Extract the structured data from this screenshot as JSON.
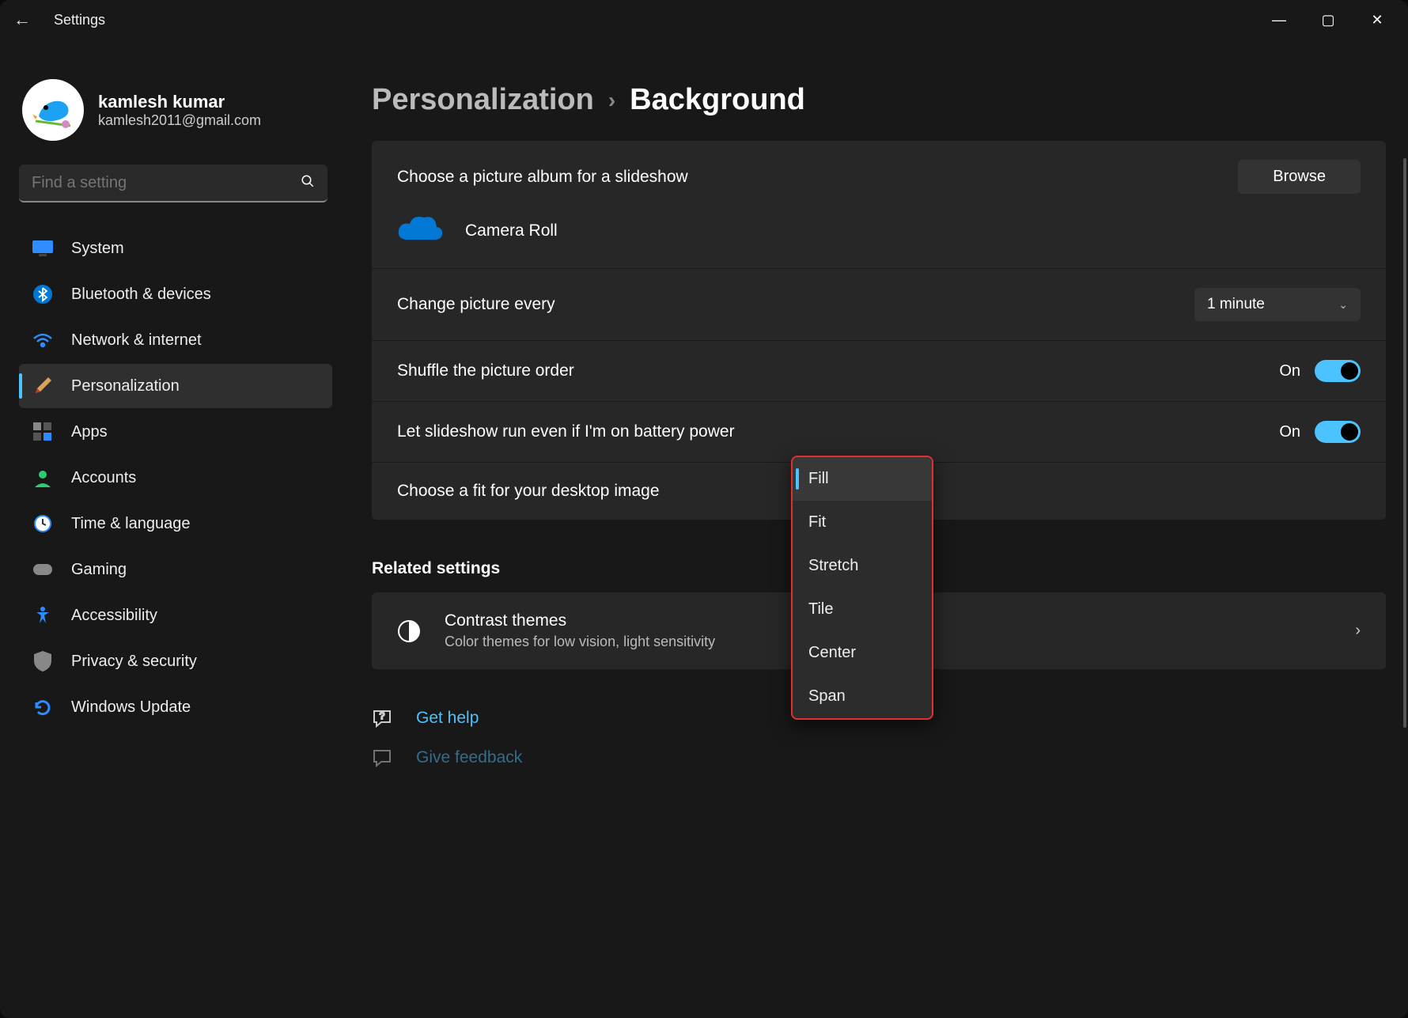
{
  "window": {
    "back_icon": "←",
    "title": "Settings",
    "min_icon": "—",
    "max_icon": "▢",
    "close_icon": "✕"
  },
  "user": {
    "name": "kamlesh kumar",
    "email": "kamlesh2011@gmail.com"
  },
  "search": {
    "placeholder": "Find a setting"
  },
  "nav": {
    "items": [
      {
        "label": "System"
      },
      {
        "label": "Bluetooth & devices"
      },
      {
        "label": "Network & internet"
      },
      {
        "label": "Personalization"
      },
      {
        "label": "Apps"
      },
      {
        "label": "Accounts"
      },
      {
        "label": "Time & language"
      },
      {
        "label": "Gaming"
      },
      {
        "label": "Accessibility"
      },
      {
        "label": "Privacy & security"
      },
      {
        "label": "Windows Update"
      }
    ],
    "active_index": 3
  },
  "breadcrumb": {
    "parent": "Personalization",
    "sep": "›",
    "current": "Background"
  },
  "settings": {
    "choose_album_label": "Choose a picture album for a slideshow",
    "browse_label": "Browse",
    "album_name": "Camera Roll",
    "change_every_label": "Change picture every",
    "change_every_value": "1 minute",
    "shuffle_label": "Shuffle the picture order",
    "shuffle_state": "On",
    "battery_label": "Let slideshow run even if I'm on battery power",
    "battery_state": "On",
    "fit_label": "Choose a fit for your desktop image"
  },
  "fit_dropdown": {
    "options": [
      {
        "label": "Fill"
      },
      {
        "label": "Fit"
      },
      {
        "label": "Stretch"
      },
      {
        "label": "Tile"
      },
      {
        "label": "Center"
      },
      {
        "label": "Span"
      }
    ],
    "selected_index": 0
  },
  "related": {
    "heading": "Related settings",
    "contrast_title": "Contrast themes",
    "contrast_sub": "Color themes for low vision, light sensitivity"
  },
  "help": {
    "get_help": "Get help",
    "give_feedback": "Give feedback"
  },
  "colors": {
    "accent": "#4cc2ff",
    "highlight_border": "#e03030"
  }
}
